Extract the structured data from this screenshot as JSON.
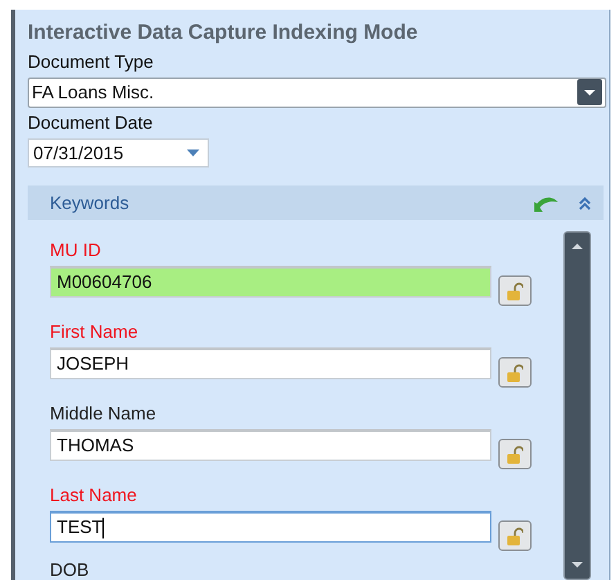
{
  "title": "Interactive Data Capture Indexing Mode",
  "document_type": {
    "label": "Document Type",
    "value": "FA Loans Misc."
  },
  "document_date": {
    "label": "Document Date",
    "value": "07/31/2015"
  },
  "keywords": {
    "title": "Keywords",
    "expanded": true,
    "fields": [
      {
        "label": "MU ID",
        "value": "M00604706",
        "required": true,
        "highlighted": true,
        "focused": false,
        "locked": false
      },
      {
        "label": "First Name",
        "value": "JOSEPH",
        "required": true,
        "highlighted": false,
        "focused": false,
        "locked": false
      },
      {
        "label": "Middle Name",
        "value": "THOMAS",
        "required": false,
        "highlighted": false,
        "focused": false,
        "locked": false
      },
      {
        "label": "Last Name",
        "value": "TEST",
        "required": true,
        "highlighted": false,
        "focused": true,
        "locked": false
      }
    ],
    "next_label": "DOB"
  }
}
